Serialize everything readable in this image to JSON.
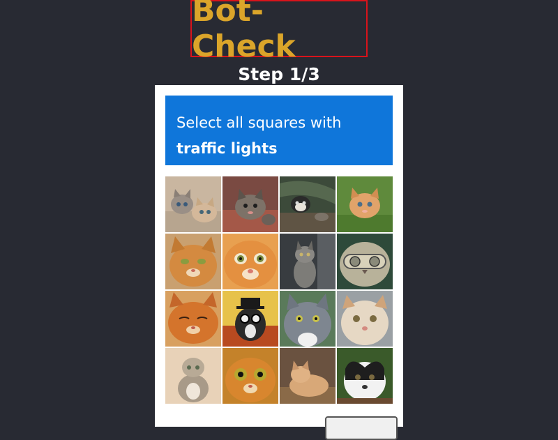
{
  "header": {
    "title": "Bot-Check",
    "step": "Step 1/3"
  },
  "challenge": {
    "instruction_line1": "Select all squares with",
    "instruction_line2": "traffic lights"
  },
  "tiles": [
    {
      "subject": "two kittens playing"
    },
    {
      "subject": "tabby kitten on blanket"
    },
    {
      "subject": "kitten with mouse on ground"
    },
    {
      "subject": "orange kitten on grass"
    },
    {
      "subject": "orange tabby cat face"
    },
    {
      "subject": "orange cat close-up face"
    },
    {
      "subject": "gray kitten sitting"
    },
    {
      "subject": "cat face with goggles"
    },
    {
      "subject": "orange cat squinting"
    },
    {
      "subject": "cartoon cat with hat and glasses"
    },
    {
      "subject": "gray cat portrait"
    },
    {
      "subject": "cream cat face"
    },
    {
      "subject": "scottish fold kitten sitting"
    },
    {
      "subject": "orange cat big eyes"
    },
    {
      "subject": "orange cat lying"
    },
    {
      "subject": "black and white cat"
    }
  ],
  "colors": {
    "background": "#282a33",
    "title": "#dba52a",
    "title_border": "#d9131b",
    "prompt_bg": "#0f76da"
  }
}
